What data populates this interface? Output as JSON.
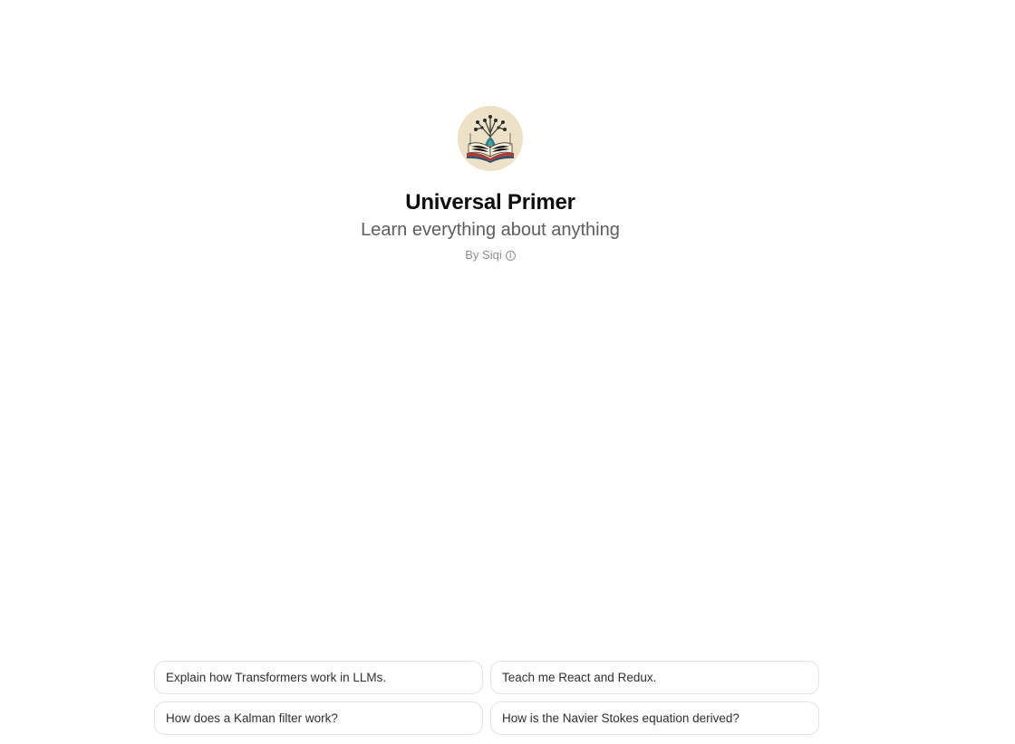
{
  "gpt": {
    "name": "Universal Primer",
    "description": "Learn everything about anything",
    "author": "By Siqi",
    "avatar_icon": "open-book-with-tree-icon"
  },
  "suggestions": [
    {
      "label": "Explain how Transformers work in LLMs."
    },
    {
      "label": "Teach me React and Redux."
    },
    {
      "label": "How does a Kalman filter work?"
    },
    {
      "label": "How is the Navier Stokes equation derived?"
    }
  ],
  "colors": {
    "background": "#ffffff",
    "title": "#0d0d0d",
    "subtitle": "#5d5d5d",
    "byline": "#8e8e8e",
    "card_border": "#e3e3e3"
  }
}
